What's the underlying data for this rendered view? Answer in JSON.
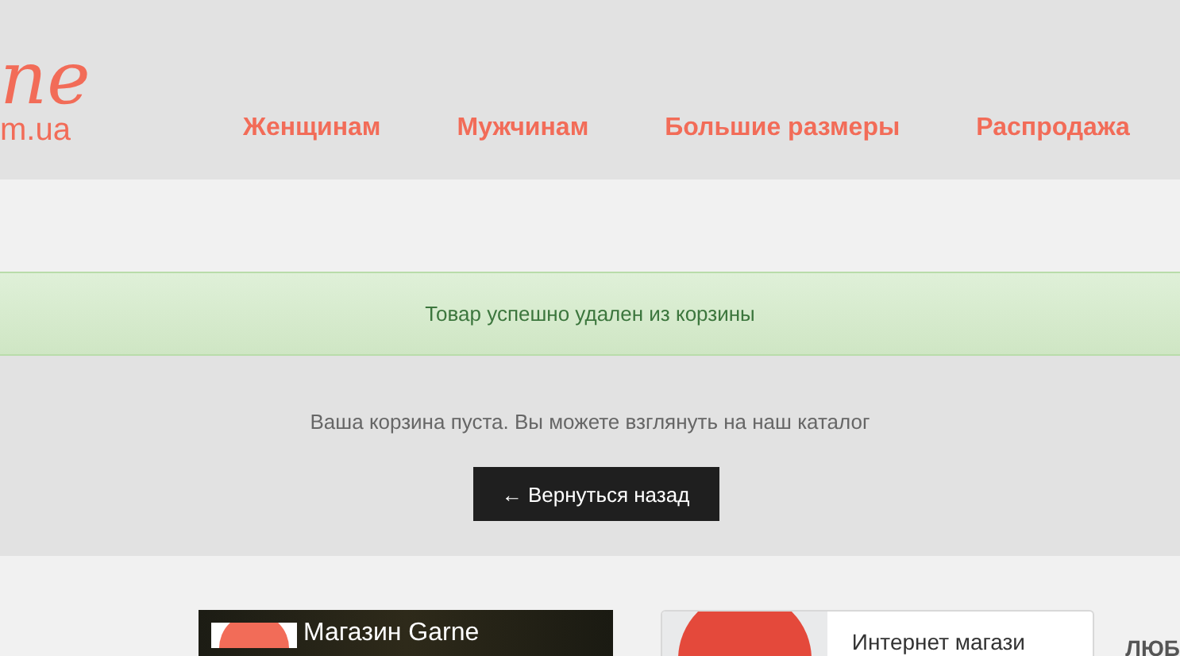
{
  "logo": {
    "script": "ne",
    "domain": "m.ua"
  },
  "nav": [
    {
      "label": "Женщинам"
    },
    {
      "label": "Мужчинам"
    },
    {
      "label": "Большие размеры"
    },
    {
      "label": "Распродажа"
    }
  ],
  "alert": {
    "text": "Товар успешно удален из корзины"
  },
  "cart": {
    "message": "Ваша корзина пуста. Вы можете взглянуть на наш каталог",
    "back_button": "← Вернуться назад"
  },
  "widgets": {
    "facebook": {
      "title": "Магазин Garne"
    },
    "google": {
      "title": "Интернет магази"
    },
    "side_heading": "ЛЮБ"
  }
}
